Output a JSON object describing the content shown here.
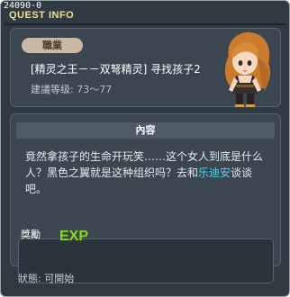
{
  "window": {
    "quest_id": "24090-0",
    "title": "QUEST INFO"
  },
  "quest": {
    "category": "職業",
    "name": "[精灵之王－－双弩精灵] 寻找孩子2",
    "level_label": "建議等级:",
    "level_range": "73～77"
  },
  "content": {
    "header": "內容",
    "text_before": "竟然拿孩子的生命开玩笑……这个女人到底是什么人？黑色之翼就是这种组织吗？去和",
    "npc_name": "乐迪安",
    "text_after": "谈谈吧。"
  },
  "reward": {
    "label": "獎勵",
    "exp_label": "EXP"
  },
  "status": {
    "label": "狀態:",
    "value": "可開始"
  },
  "colors": {
    "window_bg": "#2f3a43",
    "title": "#f0e08a",
    "npc_highlight": "#4fd7ee",
    "exp_green": "#8fd13a",
    "badge_bg": "#c8b9a7"
  },
  "icons": {
    "avatar": "npc-portrait",
    "exp": "exp-icon"
  }
}
